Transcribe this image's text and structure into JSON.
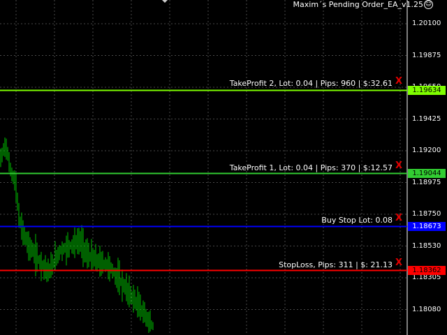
{
  "ea_title": "Maxim´s Pending Order_EA_v1.25",
  "price_axis": [
    "1.20100",
    "1.19875",
    "1.19650",
    "1.19425",
    "1.19200",
    "1.18975",
    "1.18750",
    "1.18530",
    "1.18305",
    "1.18080"
  ],
  "orders": [
    {
      "key": "tp2",
      "label": "TakeProfit 2, Lot: 0.04 | Pips: 960 | $:32.61",
      "price": "1.19634",
      "price_value": 1.19634,
      "line_color": "#7fff00",
      "tag_bg": "#7fff00",
      "tag_fg": "#000000"
    },
    {
      "key": "tp1",
      "label": "TakeProfit 1, Lot: 0.04 | Pips: 370 | $:12.57",
      "price": "1.19044",
      "price_value": 1.19044,
      "line_color": "#32cd32",
      "tag_bg": "#32cd32",
      "tag_fg": "#000000"
    },
    {
      "key": "buystop",
      "label": "Buy Stop Lot: 0.08",
      "price": "1.18673",
      "price_value": 1.18673,
      "line_color": "#0000ff",
      "tag_bg": "#0000ff",
      "tag_fg": "#ffffff"
    },
    {
      "key": "sl",
      "label": "StopLoss, Pips: 311 | $: 21.13",
      "price": "1.18362",
      "price_value": 1.18362,
      "line_color": "#ff0000",
      "tag_bg": "#ff0000",
      "tag_fg": "#000000"
    }
  ],
  "close_glyph": "X",
  "candle_color": "#00c000",
  "grid_color": "#4a4a4a"
}
